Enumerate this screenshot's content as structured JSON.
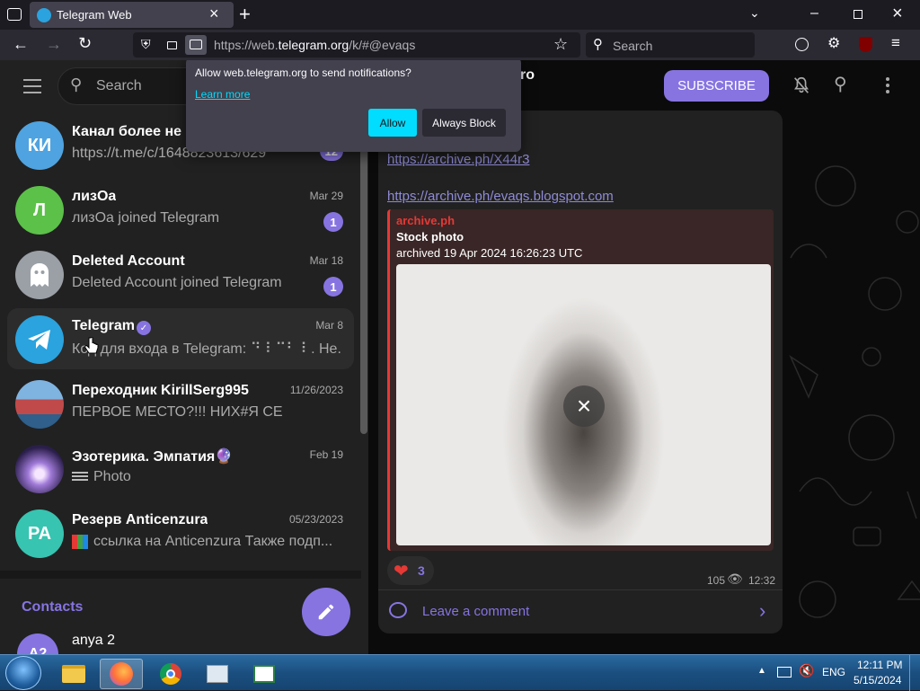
{
  "browser": {
    "tab_title": "Telegram Web",
    "url_prefix": "https://web.",
    "url_domain": "telegram.org",
    "url_suffix": "/k/#@evaqs",
    "search_placeholder": "Search"
  },
  "notification_prompt": {
    "message": "Allow web.telegram.org to send notifications?",
    "learn_more": "Learn more",
    "allow_label": "Allow",
    "block_label": "Always Block"
  },
  "sidebar": {
    "search_placeholder": "Search",
    "chats": [
      {
        "initials": "КИ",
        "name": "Канал более не и",
        "preview": "https://t.me/c/1648823613/629",
        "date": "",
        "badge": "12",
        "color": "#4fa3e0"
      },
      {
        "initials": "Л",
        "name": "лизОа",
        "preview": "лизОа joined Telegram",
        "date": "Mar 29",
        "badge": "1",
        "color": "#5cc149"
      },
      {
        "initials": "",
        "name": "Deleted Account",
        "preview": "Deleted Account joined Telegram",
        "date": "Mar 18",
        "badge": "1",
        "color": "#9aa0a6"
      },
      {
        "initials": "",
        "name": "Telegram",
        "preview": "Код для входа в Telegram: ⠙ ⠇⠉⠃ ⠇. Не...",
        "date": "Mar 8",
        "badge": "",
        "color": "#2aa3df"
      },
      {
        "initials": "",
        "name": "Переходник KirillSerg995",
        "preview": "ПЕРВОЕ МЕСТО?!!! НИХ#Я СЕ",
        "date": "11/26/2023",
        "badge": "",
        "color": "#5a8fb8"
      },
      {
        "initials": "",
        "name": "Эзотерика. Эмпатия🔮",
        "preview": "Photo",
        "date": "Feb 19",
        "badge": "",
        "color": "#4a3a7a"
      },
      {
        "initials": "РА",
        "name": "Резерв Anticenzura",
        "preview": "ссылка на Anticenzura Также подп...",
        "date": "05/23/2023",
        "badge": "",
        "color": "#37c4b0"
      }
    ],
    "contacts_title": "Contacts",
    "contact": {
      "initials": "A2",
      "name": "anya 2",
      "color": "#8774e1"
    }
  },
  "chat": {
    "title_fragment": "ro",
    "subscribe_label": "SUBSCRIBE",
    "link1": "https://archive.ph/X44r3",
    "link2": "https://archive.ph/evaqs.blogspot.com",
    "preview_site": "archive.ph",
    "preview_title": "Stock photo",
    "preview_desc": "archived 19 Apr 2024 16:26:23 UTC",
    "reaction_count": "3",
    "views": "105",
    "time": "12:32",
    "comment_label": "Leave a comment"
  },
  "taskbar": {
    "language": "ENG",
    "time": "12:11 PM",
    "date": "5/15/2024"
  },
  "colors": {
    "accent": "#8774e1",
    "link": "#8f8bd6",
    "allow_button": "#00ddff"
  }
}
